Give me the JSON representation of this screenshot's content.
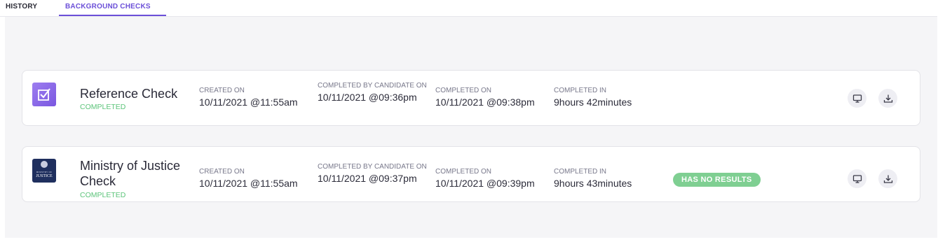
{
  "tabs": [
    {
      "label": "HISTORY",
      "active": false
    },
    {
      "label": "BACKGROUND CHECKS",
      "active": true
    }
  ],
  "accent_color": "#6b4fd8",
  "status_color": "#5cc47a",
  "checks": [
    {
      "title": "Reference Check",
      "status": "COMPLETED",
      "logo_icon": "checkbox-icon",
      "created_label": "CREATED ON",
      "created_value": "10/11/2021 @11:55am",
      "candidate_label": "COMPLETED BY CANDIDATE ON",
      "candidate_value": "10/11/2021 @09:36pm",
      "completed_label": "COMPLETED ON",
      "completed_value": "10/11/2021 @09:38pm",
      "duration_label": "COMPLETED IN",
      "duration_value": "9hours 42minutes",
      "actions": [
        "monitor-icon",
        "download-icon"
      ]
    },
    {
      "title": "Ministry of Justice Check",
      "status": "COMPLETED",
      "logo_icon": "ministry-of-justice-logo",
      "logo_text_small": "MINISTRY OF",
      "logo_text_big": "JUSTICE",
      "created_label": "CREATED ON",
      "created_value": "10/11/2021 @11:55am",
      "candidate_label": "COMPLETED BY CANDIDATE ON",
      "candidate_value": "10/11/2021 @09:37pm",
      "completed_label": "COMPLETED ON",
      "completed_value": "10/11/2021 @09:39pm",
      "duration_label": "COMPLETED IN",
      "duration_value": "9hours 43minutes",
      "badge": "HAS NO RESULTS",
      "actions": [
        "monitor-icon",
        "download-icon"
      ]
    }
  ]
}
